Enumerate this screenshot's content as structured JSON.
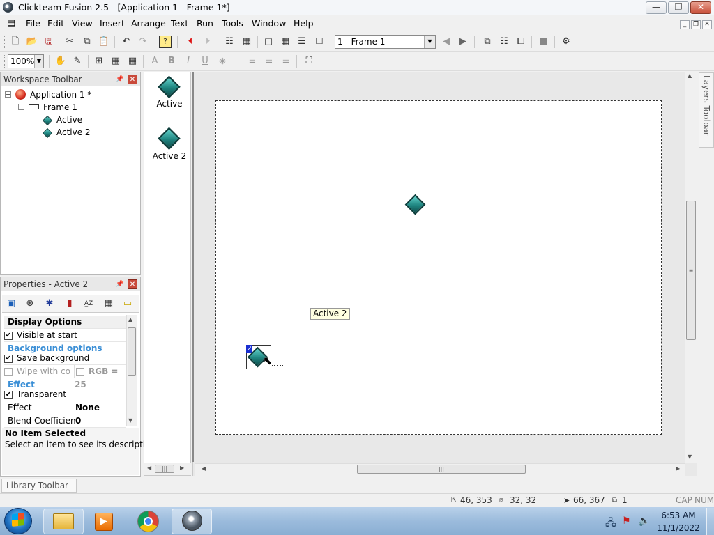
{
  "window": {
    "title": "Clickteam Fusion 2.5 - [Application 1 - Frame 1*]",
    "minimize_glyph": "—",
    "maximize_glyph": "❐",
    "close_glyph": "✕"
  },
  "menu": [
    "File",
    "Edit",
    "View",
    "Insert",
    "Arrange",
    "Text",
    "Run",
    "Tools",
    "Window",
    "Help"
  ],
  "toolbar": {
    "frame_select": "1 - Frame 1",
    "zoom": "100%"
  },
  "workspace": {
    "title": "Workspace Toolbar",
    "tree": {
      "app": "Application 1 *",
      "frame": "Frame 1",
      "objects": [
        "Active",
        "Active 2"
      ]
    }
  },
  "object_list": [
    "Active",
    "Active 2"
  ],
  "properties": {
    "title": "Properties - Active 2",
    "sections": {
      "display": "Display Options",
      "background": "Background options",
      "effect": "Effect"
    },
    "rows": {
      "visible_at_start": "Visible at start",
      "save_background": "Save background",
      "wipe_with_color": "Wipe with co",
      "rgb": "RGB = 25",
      "transparent": "Transparent",
      "effect_label": "Effect",
      "effect_value": "None",
      "blend_label": "Blend Coefficient",
      "blend_value": "0"
    },
    "checked": {
      "visible_at_start": true,
      "save_background": true,
      "wipe_with_color": false,
      "transparent": true
    },
    "description": {
      "title": "No Item Selected",
      "text": "Select an item to see its description"
    }
  },
  "layers_toolbar": "Layers Toolbar",
  "library_toolbar": "Library Toolbar",
  "frame_editor": {
    "tooltip": "Active 2",
    "selected_badge": "2"
  },
  "statusbar": {
    "position": "46, 353",
    "size": "32, 32",
    "cursor": "66, 367",
    "count": "1",
    "caps": "CAP",
    "num": "NUM"
  },
  "taskbar": {
    "time": "6:53 AM",
    "date": "11/1/2022"
  },
  "colors": {
    "accent_section": "#3b8fd6",
    "object_teal": "#1f8580",
    "selection_blue": "#1a2fd0",
    "tooltip_bg": "#ffffe1"
  }
}
